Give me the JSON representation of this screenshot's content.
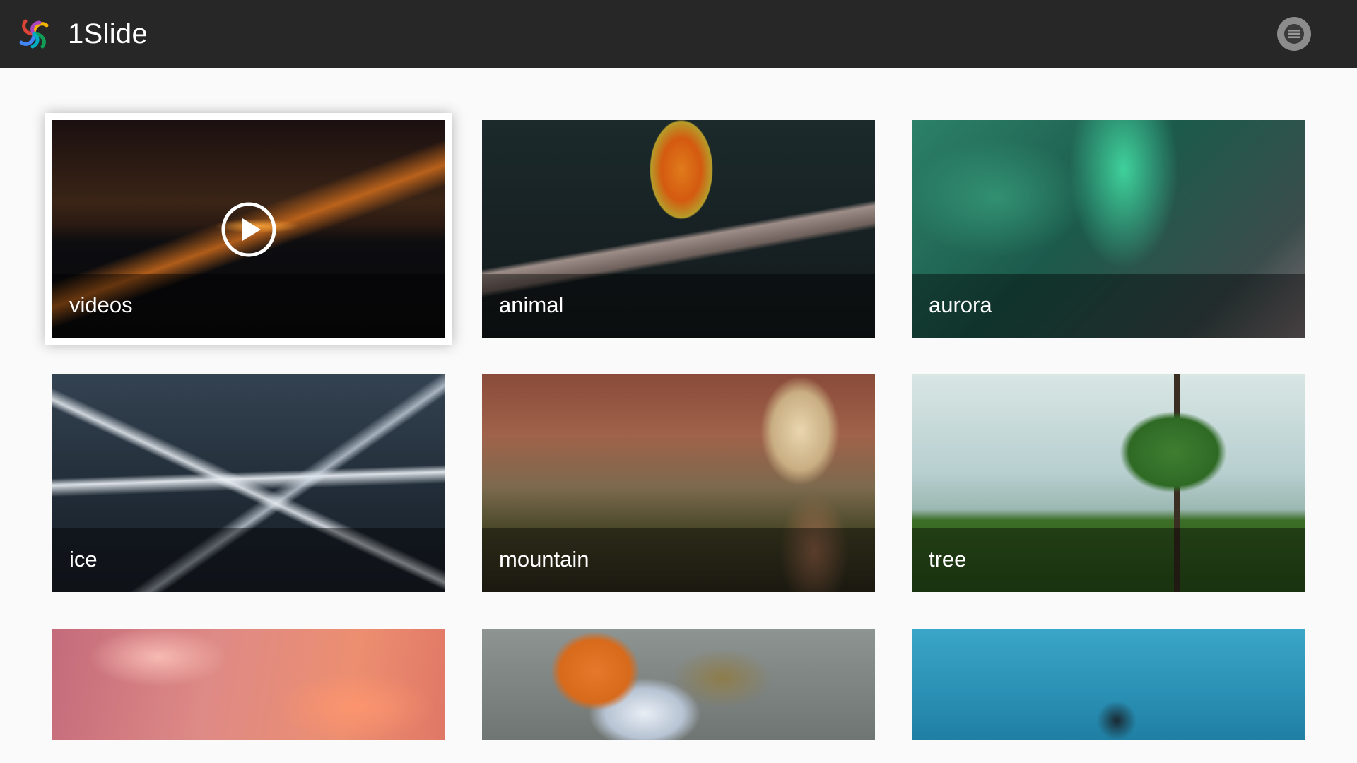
{
  "app": {
    "title": "1Slide",
    "logo_icon": "pinwheel-logo-icon",
    "menu_icon": "hamburger-menu-icon"
  },
  "grid": {
    "selected_index": 0,
    "tiles": [
      {
        "label": "videos",
        "has_play_icon": true
      },
      {
        "label": "animal"
      },
      {
        "label": "aurora"
      },
      {
        "label": "ice"
      },
      {
        "label": "mountain"
      },
      {
        "label": "tree"
      },
      {
        "label": ""
      },
      {
        "label": ""
      },
      {
        "label": ""
      }
    ]
  },
  "colors": {
    "topbar": "#272727",
    "background": "#fafafa",
    "label_text": "#ffffff",
    "menu_button": "#8c8c8c"
  }
}
